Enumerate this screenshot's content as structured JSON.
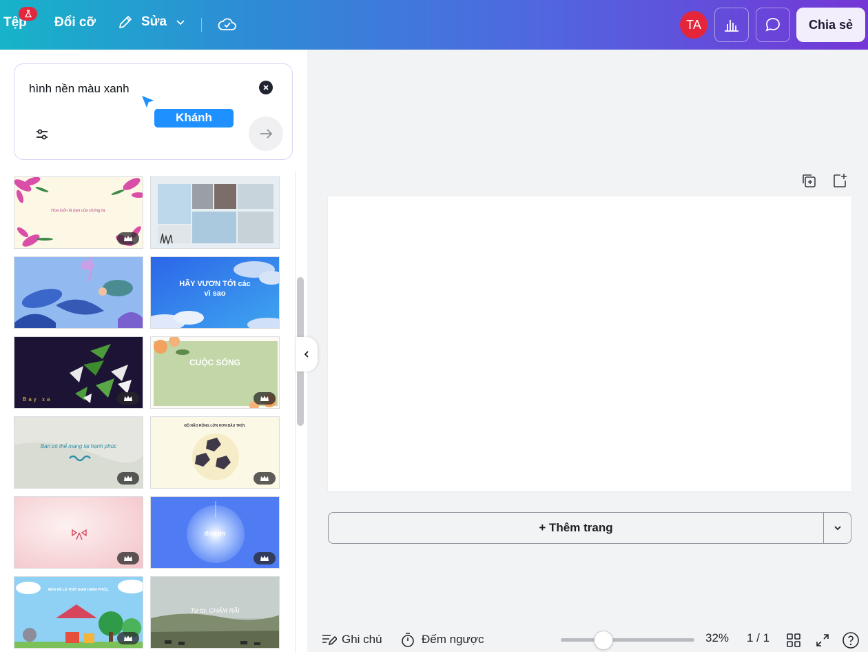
{
  "topbar": {
    "file_label": "Tệp",
    "file_badge_icon": "beaker-icon",
    "resize_label": "Đổi cỡ",
    "edit_label": "Sửa",
    "avatar_initials": "TA",
    "share_label": "Chia sẻ"
  },
  "search": {
    "query": "hình nền màu xanh"
  },
  "collaborator": {
    "name": "Khánh",
    "color": "#1e90ff"
  },
  "results": [
    {
      "text": "Hoa luôn là bạn của chúng ta.",
      "premium": true
    },
    {
      "text": "",
      "premium": false
    },
    {
      "text": "",
      "premium": false
    },
    {
      "text": "HÃY VƯƠN TỚI các vì sao",
      "premium": false
    },
    {
      "text": "Bay xa",
      "premium": true
    },
    {
      "text": "CUỘC SỐNG",
      "premium": true
    },
    {
      "text": "Bạn có thể mang lại hạnh phúc",
      "premium": true
    },
    {
      "text": "ĐỘ NÃO RỘNG LỚN HƠN BẦU TRỜI.",
      "premium": true
    },
    {
      "text": "",
      "premium": true
    },
    {
      "text": "đức tin",
      "premium": true
    },
    {
      "text": "MÙA HÈ LÀ THỜI GIAN HẠNH PHÚC.",
      "premium": true
    },
    {
      "text": "Từ từ, CHẬM RÃI",
      "premium": false
    }
  ],
  "canvas": {
    "add_page_label": "+ Thêm trang"
  },
  "bottombar": {
    "notes_label": "Ghi chú",
    "timer_label": "Đếm ngược",
    "zoom_value": "32%",
    "zoom_level": 0.32,
    "page_indicator": "1 / 1"
  },
  "colors": {
    "badge": "#e0283e",
    "avatar": "#e5253a",
    "accent": "#7436d6"
  }
}
